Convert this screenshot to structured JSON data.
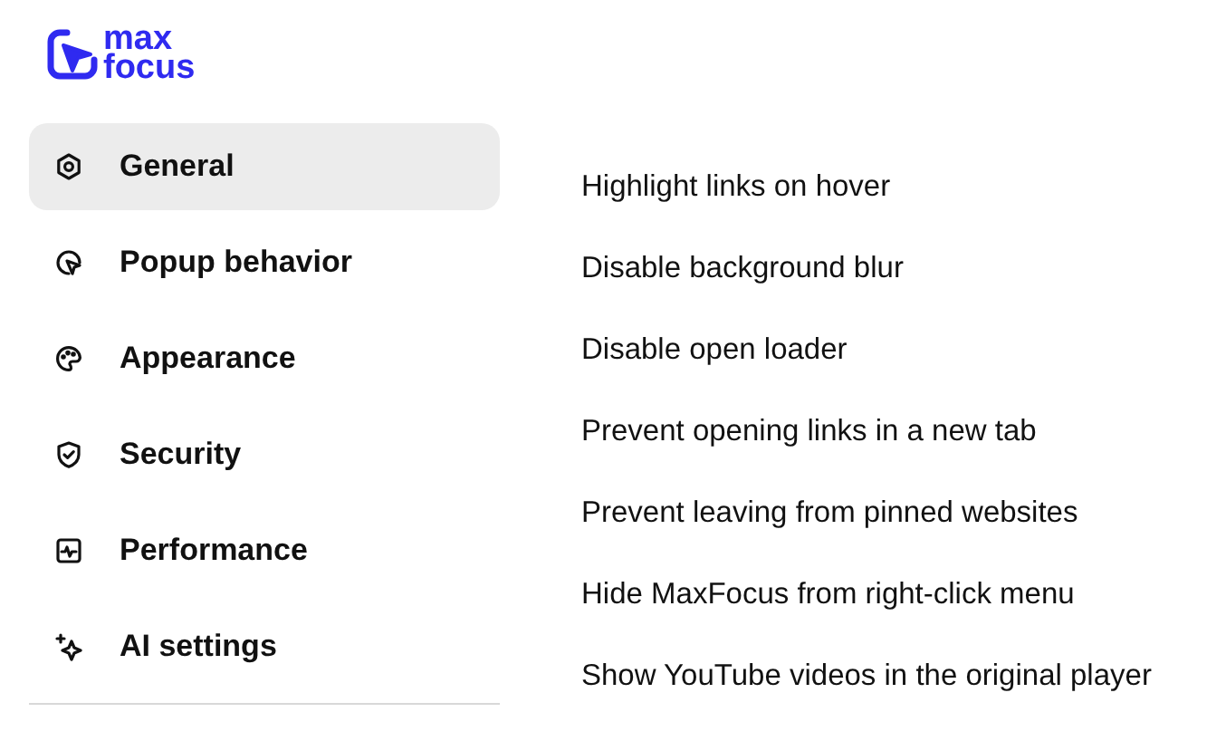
{
  "logo": {
    "line_1": "max",
    "line_2": "focus"
  },
  "sidebar": {
    "items": [
      {
        "label": "General",
        "selected": true
      },
      {
        "label": "Popup behavior",
        "selected": false
      },
      {
        "label": "Appearance",
        "selected": false
      },
      {
        "label": "Security",
        "selected": false
      },
      {
        "label": "Performance",
        "selected": false
      },
      {
        "label": "AI settings",
        "selected": false
      }
    ]
  },
  "settings": [
    {
      "label": "Highlight links on hover"
    },
    {
      "label": "Disable background blur"
    },
    {
      "label": "Disable open loader"
    },
    {
      "label": "Prevent opening links in a new tab"
    },
    {
      "label": "Prevent leaving from pinned websites"
    },
    {
      "label": "Hide MaxFocus from right-click menu"
    },
    {
      "label": "Show YouTube videos in the original player"
    }
  ]
}
